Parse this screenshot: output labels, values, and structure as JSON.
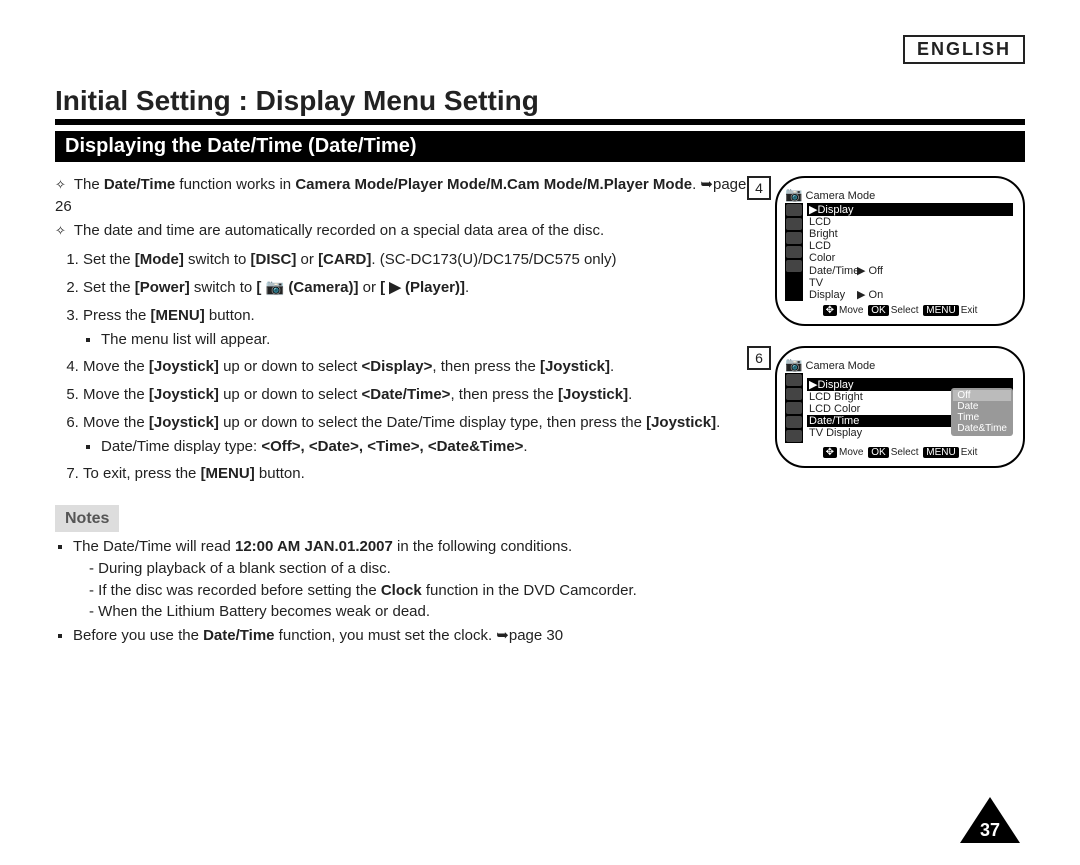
{
  "lang_label": "ENGLISH",
  "title": "Initial Setting : Display Menu Setting",
  "section_title": "Displaying the Date/Time (Date/Time)",
  "intro": {
    "line1_pre": "The ",
    "line1_b1": "Date/Time",
    "line1_mid": " function works in ",
    "line1_b2": "Camera Mode/Player Mode/M.Cam Mode/M.Player Mode",
    "line1_post": ". ➥page 26",
    "line2": "The date and time are automatically recorded on a special data area of the disc."
  },
  "steps": {
    "s1_pre": "Set the ",
    "s1_b1": "[Mode]",
    "s1_mid": " switch to ",
    "s1_b2": "[DISC]",
    "s1_or": " or ",
    "s1_b3": "[CARD]",
    "s1_post": ". (SC-DC173(U)/DC175/DC575 only)",
    "s2_pre": "Set the ",
    "s2_b1": "[Power]",
    "s2_mid": " switch to ",
    "s2_b2": "[ 📷 (Camera)]",
    "s2_or": " or ",
    "s2_b3": "[ ▶ (Player)]",
    "s2_post": ".",
    "s3_pre": "Press the ",
    "s3_b1": "[MENU]",
    "s3_post": " button.",
    "s3_sub": "The menu list will appear.",
    "s4_pre": "Move the ",
    "s4_b1": "[Joystick]",
    "s4_mid": " up or down to select ",
    "s4_b2": "<Display>",
    "s4_mid2": ", then press the ",
    "s4_b3": "[Joystick]",
    "s4_post": ".",
    "s5_pre": "Move the ",
    "s5_b1": "[Joystick]",
    "s5_mid": " up or down to select ",
    "s5_b2": "<Date/Time>",
    "s5_mid2": ", then press the ",
    "s5_b3": "[Joystick]",
    "s5_post": ".",
    "s6_pre": "Move the ",
    "s6_b1": "[Joystick]",
    "s6_mid": " up or down to select the Date/Time display type, then press the ",
    "s6_b2": "[Joystick]",
    "s6_post": ".",
    "s6_sub_pre": "Date/Time display type: ",
    "s6_sub_b": "<Off>, <Date>, <Time>, <Date&Time>",
    "s6_sub_post": ".",
    "s7_pre": "To exit, press the ",
    "s7_b1": "[MENU]",
    "s7_post": " button."
  },
  "notes": {
    "heading": "Notes",
    "n1_pre": "The Date/Time will read ",
    "n1_b": "12:00 AM JAN.01.2007",
    "n1_post": " in the following conditions.",
    "n1a": "During playback of a blank section of a disc.",
    "n1b_pre": "If the disc was recorded before setting the ",
    "n1b_b": "Clock",
    "n1b_post": " function in the DVD Camcorder.",
    "n1c": "When the Lithium Battery becomes weak or dead.",
    "n2_pre": "Before you use the ",
    "n2_b": "Date/Time",
    "n2_post": " function, you must set the clock. ➥page 30"
  },
  "screen4": {
    "badge": "4",
    "mode": "Camera Mode",
    "highlight": "▶Display",
    "items": [
      "LCD Bright",
      "LCD Color",
      "Date/Time",
      "TV Display"
    ],
    "vals": [
      "",
      "",
      "▶ Off",
      "▶ On"
    ],
    "hint_move": "Move",
    "hint_select": "Select",
    "hint_exit": "Exit"
  },
  "screen6": {
    "badge": "6",
    "mode": "Camera Mode",
    "highlight": "▶Display",
    "items": [
      "LCD Bright",
      "LCD Color",
      "Date/Time",
      "TV Display"
    ],
    "popup": [
      "Off",
      "Date",
      "Time",
      "Date&Time"
    ],
    "hint_move": "Move",
    "hint_select": "Select",
    "hint_exit": "Exit"
  },
  "page_number": "37"
}
